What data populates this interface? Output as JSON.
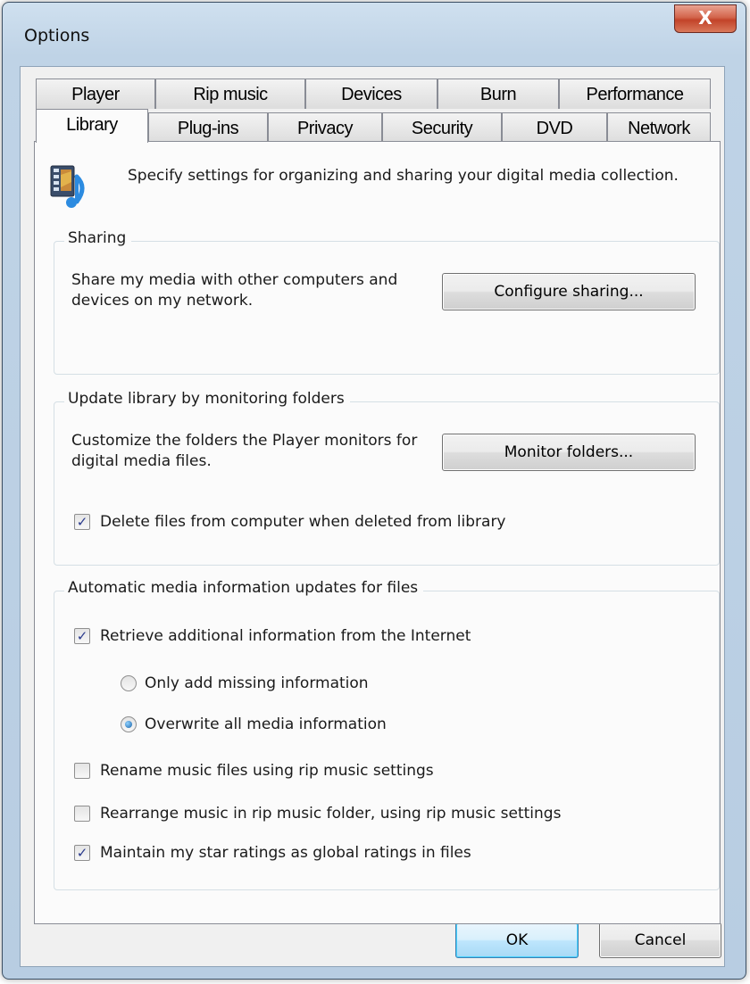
{
  "window": {
    "title": "Options",
    "close_glyph": "X",
    "close_icon": "close-icon"
  },
  "tabs": {
    "row_back": [
      "Player",
      "Rip music",
      "Devices",
      "Burn",
      "Performance"
    ],
    "row_front": [
      "Library",
      "Plug-ins",
      "Privacy",
      "Security",
      "DVD",
      "Network"
    ],
    "active": "Library"
  },
  "intro": {
    "icon": "media-library-icon",
    "text": "Specify settings for organizing and sharing your digital media collection."
  },
  "sharing": {
    "legend": "Sharing",
    "description": "Share my media with other computers and devices on my network.",
    "button": "Configure sharing..."
  },
  "monitoring": {
    "legend": "Update library by monitoring folders",
    "description": "Customize the folders the Player monitors for digital media files.",
    "button": "Monitor folders...",
    "delete_files": {
      "label": "Delete files from computer when deleted from library",
      "checked": true
    }
  },
  "auto_updates": {
    "legend": "Automatic media information updates for files",
    "retrieve": {
      "label": "Retrieve additional information from the Internet",
      "checked": true
    },
    "radio_missing": {
      "label": "Only add missing information",
      "selected": false
    },
    "radio_overwrite": {
      "label": "Overwrite all media information",
      "selected": true
    },
    "rename": {
      "label": "Rename music files using rip music settings",
      "checked": false
    },
    "rearrange": {
      "label": "Rearrange music in rip music folder, using rip music settings",
      "checked": false
    },
    "ratings": {
      "label": "Maintain my star ratings as global ratings in files",
      "checked": true
    }
  },
  "footer": {
    "ok": "OK",
    "cancel": "Cancel"
  },
  "checkmark_glyph": "✓"
}
